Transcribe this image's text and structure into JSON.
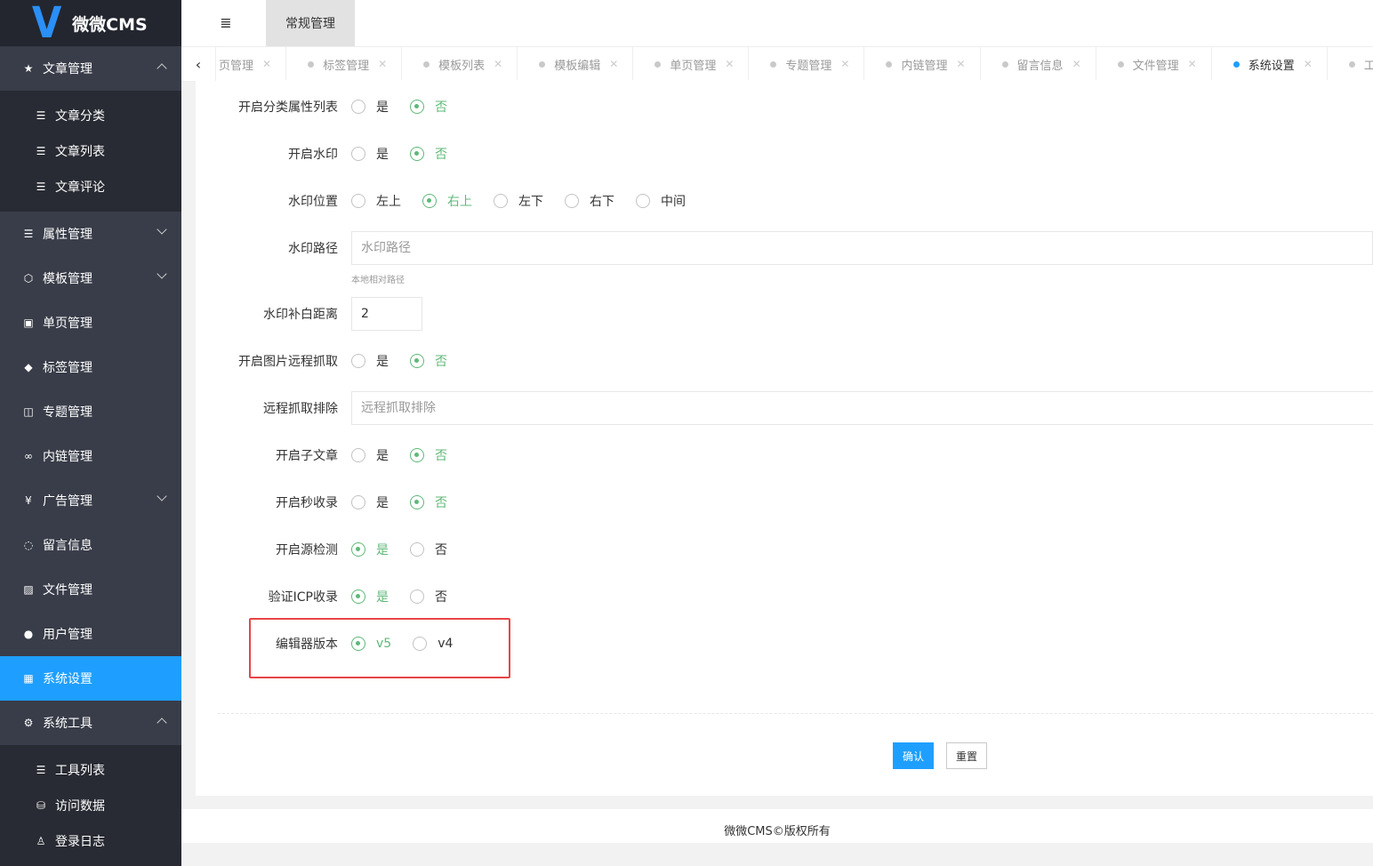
{
  "logo": {
    "mark": "V",
    "text": "微微CMS"
  },
  "header": {
    "menu_icon": "≣",
    "tab": "常规管理"
  },
  "sidebar": {
    "items": [
      {
        "label": "文章管理",
        "icon": "★",
        "arrow": "up"
      },
      {
        "label": "文章分类",
        "icon": "☰",
        "sub": true
      },
      {
        "label": "文章列表",
        "icon": "☰",
        "sub": true
      },
      {
        "label": "文章评论",
        "icon": "☰",
        "sub": true
      },
      {
        "label": "属性管理",
        "icon": "☰",
        "arrow": "down"
      },
      {
        "label": "模板管理",
        "icon": "⬡",
        "arrow": "down"
      },
      {
        "label": "单页管理",
        "icon": "▣"
      },
      {
        "label": "标签管理",
        "icon": "◆"
      },
      {
        "label": "专题管理",
        "icon": "◫"
      },
      {
        "label": "内链管理",
        "icon": "∞"
      },
      {
        "label": "广告管理",
        "icon": "¥",
        "arrow": "down"
      },
      {
        "label": "留言信息",
        "icon": "◌"
      },
      {
        "label": "文件管理",
        "icon": "▨"
      },
      {
        "label": "用户管理",
        "icon": "●"
      },
      {
        "label": "系统设置",
        "icon": "▦",
        "active": true
      },
      {
        "label": "系统工具",
        "icon": "⚙",
        "arrow": "up"
      },
      {
        "label": "工具列表",
        "icon": "☰",
        "sub": true
      },
      {
        "label": "访问数据",
        "icon": "⛁",
        "sub": true
      },
      {
        "label": "登录日志",
        "icon": "♙",
        "sub": true
      }
    ]
  },
  "tabs": {
    "prev_icon": "‹",
    "close_icon": "✕",
    "items": [
      {
        "label": "页管理",
        "partial": true
      },
      {
        "label": "标签管理"
      },
      {
        "label": "模板列表"
      },
      {
        "label": "模板编辑"
      },
      {
        "label": "单页管理"
      },
      {
        "label": "专题管理"
      },
      {
        "label": "内链管理"
      },
      {
        "label": "留言信息"
      },
      {
        "label": "文件管理"
      },
      {
        "label": "系统设置",
        "active": true
      },
      {
        "label": "工具列表"
      }
    ]
  },
  "form": {
    "category_attr": {
      "label": "开启分类属性列表",
      "options": [
        "是",
        "否"
      ],
      "selected": 1
    },
    "watermark": {
      "label": "开启水印",
      "options": [
        "是",
        "否"
      ],
      "selected": 1
    },
    "watermark_pos": {
      "label": "水印位置",
      "options": [
        "左上",
        "右上",
        "左下",
        "右下",
        "中间"
      ],
      "selected": 1
    },
    "watermark_path": {
      "label": "水印路径",
      "placeholder": "水印路径",
      "hint": "本地相对路径"
    },
    "watermark_padding": {
      "label": "水印补白距离",
      "value": "2"
    },
    "remote_fetch": {
      "label": "开启图片远程抓取",
      "options": [
        "是",
        "否"
      ],
      "selected": 1
    },
    "remote_exclude": {
      "label": "远程抓取排除",
      "placeholder": "远程抓取排除"
    },
    "sub_article": {
      "label": "开启子文章",
      "options": [
        "是",
        "否"
      ],
      "selected": 1
    },
    "instant_index": {
      "label": "开启秒收录",
      "options": [
        "是",
        "否"
      ],
      "selected": 1
    },
    "source_check": {
      "label": "开启源检测",
      "options": [
        "是",
        "否"
      ],
      "selected": 0
    },
    "icp_verify": {
      "label": "验证ICP收录",
      "options": [
        "是",
        "否"
      ],
      "selected": 0
    },
    "editor_version": {
      "label": "编辑器版本",
      "options": [
        "v5",
        "v4"
      ],
      "selected": 0
    },
    "confirm_label": "确认",
    "reset_label": "重置"
  },
  "footer": {
    "text": "微微CMS©版权所有"
  }
}
